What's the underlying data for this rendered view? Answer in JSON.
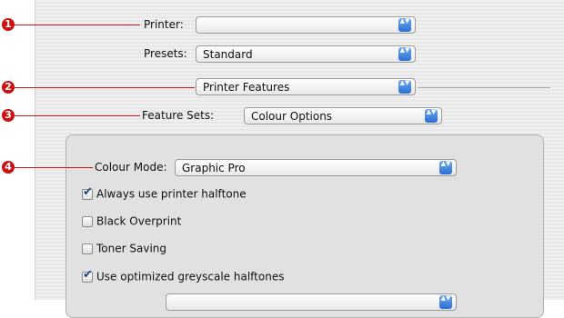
{
  "callouts": [
    "1",
    "2",
    "3",
    "4"
  ],
  "printer": {
    "label": "Printer:",
    "value": ""
  },
  "presets": {
    "label": "Presets:",
    "value": "Standard"
  },
  "panel": {
    "value": "Printer Features"
  },
  "feature_sets": {
    "label": "Feature Sets:",
    "value": "Colour Options"
  },
  "colour_mode": {
    "label": "Colour Mode:",
    "value": "Graphic Pro"
  },
  "checkboxes": [
    {
      "label": "Always use printer halftone",
      "checked": true
    },
    {
      "label": "Black Overprint",
      "checked": false
    },
    {
      "label": "Toner Saving",
      "checked": false
    },
    {
      "label": "Use optimized greyscale halftones",
      "checked": true
    }
  ],
  "popup_arrows": "▲▼",
  "colors": {
    "callout": "#cc1111",
    "accent": "#2a6fd6"
  }
}
